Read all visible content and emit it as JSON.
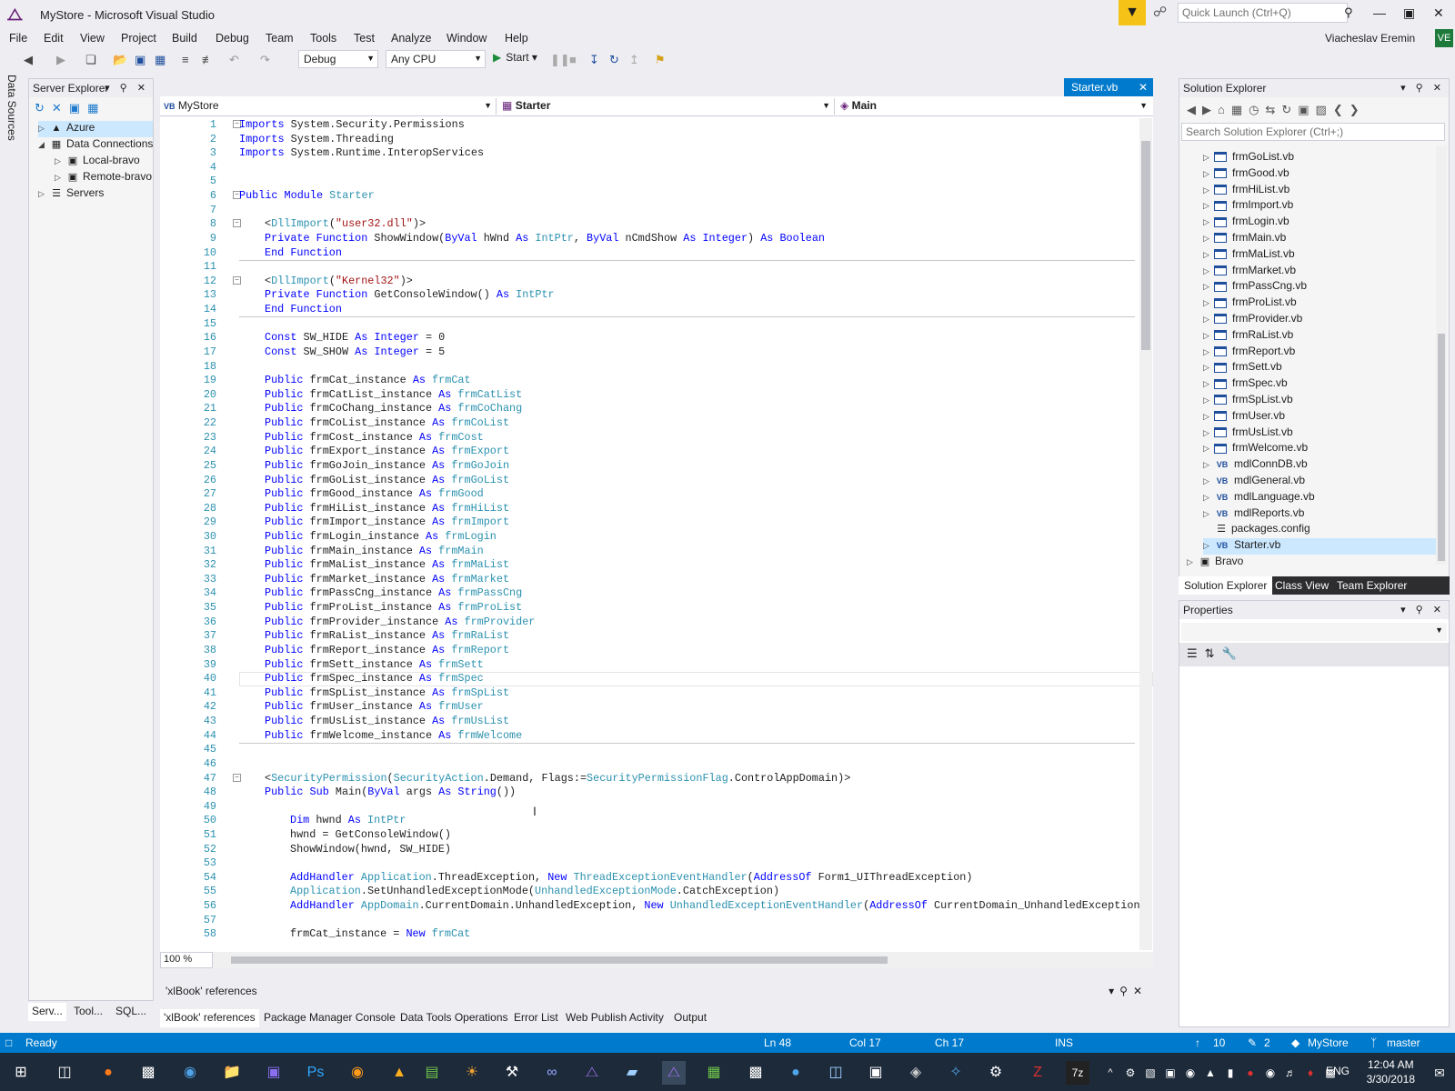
{
  "window": {
    "title": "MyStore - Microsoft Visual Studio",
    "quick_launch": "Quick Launch (Ctrl+Q)",
    "user": "Viacheslav Eremin",
    "avatar": "VE",
    "min": "—",
    "max": "▣",
    "close": "✕"
  },
  "menu": [
    "File",
    "Edit",
    "View",
    "Project",
    "Build",
    "Debug",
    "Team",
    "Tools",
    "Test",
    "Analyze",
    "Window",
    "Help"
  ],
  "toolbar": {
    "config": "Debug",
    "platform": "Any CPU",
    "start": "Start"
  },
  "left_strip": {
    "label": "Data Sources"
  },
  "server_explorer": {
    "title": "Server Explorer",
    "items": [
      {
        "label": "Azure",
        "arrow": "▷",
        "icon": "▲",
        "indent": 0,
        "selected": true
      },
      {
        "label": "Data Connections",
        "arrow": "◢",
        "icon": "▦",
        "indent": 0
      },
      {
        "label": "Local-bravo",
        "arrow": "▷",
        "icon": "▣",
        "indent": 1
      },
      {
        "label": "Remote-bravo",
        "arrow": "▷",
        "icon": "▣",
        "indent": 1
      },
      {
        "label": "Servers",
        "arrow": "▷",
        "icon": "☰",
        "indent": 0
      }
    ],
    "tabs": [
      "Serv...",
      "Tool...",
      "SQL..."
    ]
  },
  "editor": {
    "tab": "Starter.vb",
    "nav": {
      "project": "MyStore",
      "class": "Starter",
      "member": "Main"
    },
    "zoom": "100 %"
  },
  "code": [
    {
      "n": 1,
      "segs": [
        [
          "kw",
          "Imports"
        ],
        [
          "tx",
          " System.Security.Permissions"
        ]
      ],
      "ind": 0,
      "col": true
    },
    {
      "n": 2,
      "segs": [
        [
          "kw",
          "Imports"
        ],
        [
          "tx",
          " System.Threading"
        ]
      ],
      "ind": 0
    },
    {
      "n": 3,
      "segs": [
        [
          "kw",
          "Imports"
        ],
        [
          "tx",
          " System.Runtime.InteropServices"
        ]
      ],
      "ind": 0
    },
    {
      "n": 4,
      "segs": [],
      "ind": 0
    },
    {
      "n": 5,
      "segs": [],
      "ind": 0
    },
    {
      "n": 6,
      "segs": [
        [
          "kw",
          "Public Module"
        ],
        [
          "ty",
          " Starter"
        ]
      ],
      "ind": 0,
      "col": true
    },
    {
      "n": 7,
      "segs": [],
      "ind": 0
    },
    {
      "n": 8,
      "segs": [
        [
          "tx",
          "<"
        ],
        [
          "ty",
          "DllImport"
        ],
        [
          "tx",
          "("
        ],
        [
          "st",
          "\"user32.dll\""
        ],
        [
          "tx",
          ")>"
        ]
      ],
      "ind": 1,
      "col": true
    },
    {
      "n": 9,
      "segs": [
        [
          "kw",
          "Private Function"
        ],
        [
          "tx",
          " ShowWindow("
        ],
        [
          "kw",
          "ByVal"
        ],
        [
          "tx",
          " hWnd "
        ],
        [
          "kw",
          "As"
        ],
        [
          "ty",
          " IntPtr"
        ],
        [
          "tx",
          ", "
        ],
        [
          "kw",
          "ByVal"
        ],
        [
          "tx",
          " nCmdShow "
        ],
        [
          "kw",
          "As Integer"
        ],
        [
          "tx",
          ") "
        ],
        [
          "kw",
          "As Boolean"
        ]
      ],
      "ind": 1
    },
    {
      "n": 10,
      "segs": [
        [
          "kw",
          "End Function"
        ]
      ],
      "ind": 1,
      "sep": true
    },
    {
      "n": 11,
      "segs": [],
      "ind": 0
    },
    {
      "n": 12,
      "segs": [
        [
          "tx",
          "<"
        ],
        [
          "ty",
          "DllImport"
        ],
        [
          "tx",
          "("
        ],
        [
          "st",
          "\"Kernel32\""
        ],
        [
          "tx",
          ")>"
        ]
      ],
      "ind": 1,
      "col": true
    },
    {
      "n": 13,
      "segs": [
        [
          "kw",
          "Private Function"
        ],
        [
          "tx",
          " GetConsoleWindow() "
        ],
        [
          "kw",
          "As"
        ],
        [
          "ty",
          " IntPtr"
        ]
      ],
      "ind": 1
    },
    {
      "n": 14,
      "segs": [
        [
          "kw",
          "End Function"
        ]
      ],
      "ind": 1,
      "sep": true
    },
    {
      "n": 15,
      "segs": [],
      "ind": 0
    },
    {
      "n": 16,
      "segs": [
        [
          "kw",
          "Const"
        ],
        [
          "tx",
          " SW_HIDE "
        ],
        [
          "kw",
          "As Integer"
        ],
        [
          "tx",
          " = 0"
        ]
      ],
      "ind": 1
    },
    {
      "n": 17,
      "segs": [
        [
          "kw",
          "Const"
        ],
        [
          "tx",
          " SW_SHOW "
        ],
        [
          "kw",
          "As Integer"
        ],
        [
          "tx",
          " = 5"
        ]
      ],
      "ind": 1
    },
    {
      "n": 18,
      "segs": [],
      "ind": 0
    },
    {
      "n": 19,
      "segs": [
        [
          "kw",
          "Public"
        ],
        [
          "tx",
          " frmCat_instance "
        ],
        [
          "kw",
          "As"
        ],
        [
          "ty",
          " frmCat"
        ]
      ],
      "ind": 1
    },
    {
      "n": 20,
      "segs": [
        [
          "kw",
          "Public"
        ],
        [
          "tx",
          " frmCatList_instance "
        ],
        [
          "kw",
          "As"
        ],
        [
          "ty",
          " frmCatList"
        ]
      ],
      "ind": 1
    },
    {
      "n": 21,
      "segs": [
        [
          "kw",
          "Public"
        ],
        [
          "tx",
          " frmCoChang_instance "
        ],
        [
          "kw",
          "As"
        ],
        [
          "ty",
          " frmCoChang"
        ]
      ],
      "ind": 1
    },
    {
      "n": 22,
      "segs": [
        [
          "kw",
          "Public"
        ],
        [
          "tx",
          " frmCoList_instance "
        ],
        [
          "kw",
          "As"
        ],
        [
          "ty",
          " frmCoList"
        ]
      ],
      "ind": 1
    },
    {
      "n": 23,
      "segs": [
        [
          "kw",
          "Public"
        ],
        [
          "tx",
          " frmCost_instance "
        ],
        [
          "kw",
          "As"
        ],
        [
          "ty",
          " frmCost"
        ]
      ],
      "ind": 1
    },
    {
      "n": 24,
      "segs": [
        [
          "kw",
          "Public"
        ],
        [
          "tx",
          " frmExport_instance "
        ],
        [
          "kw",
          "As"
        ],
        [
          "ty",
          " frmExport"
        ]
      ],
      "ind": 1
    },
    {
      "n": 25,
      "segs": [
        [
          "kw",
          "Public"
        ],
        [
          "tx",
          " frmGoJoin_instance "
        ],
        [
          "kw",
          "As"
        ],
        [
          "ty",
          " frmGoJoin"
        ]
      ],
      "ind": 1
    },
    {
      "n": 26,
      "segs": [
        [
          "kw",
          "Public"
        ],
        [
          "tx",
          " frmGoList_instance "
        ],
        [
          "kw",
          "As"
        ],
        [
          "ty",
          " frmGoList"
        ]
      ],
      "ind": 1
    },
    {
      "n": 27,
      "segs": [
        [
          "kw",
          "Public"
        ],
        [
          "tx",
          " frmGood_instance "
        ],
        [
          "kw",
          "As"
        ],
        [
          "ty",
          " frmGood"
        ]
      ],
      "ind": 1
    },
    {
      "n": 28,
      "segs": [
        [
          "kw",
          "Public"
        ],
        [
          "tx",
          " frmHiList_instance "
        ],
        [
          "kw",
          "As"
        ],
        [
          "ty",
          " frmHiList"
        ]
      ],
      "ind": 1
    },
    {
      "n": 29,
      "segs": [
        [
          "kw",
          "Public"
        ],
        [
          "tx",
          " frmImport_instance "
        ],
        [
          "kw",
          "As"
        ],
        [
          "ty",
          " frmImport"
        ]
      ],
      "ind": 1
    },
    {
      "n": 30,
      "segs": [
        [
          "kw",
          "Public"
        ],
        [
          "tx",
          " frmLogin_instance "
        ],
        [
          "kw",
          "As"
        ],
        [
          "ty",
          " frmLogin"
        ]
      ],
      "ind": 1
    },
    {
      "n": 31,
      "segs": [
        [
          "kw",
          "Public"
        ],
        [
          "tx",
          " frmMain_instance "
        ],
        [
          "kw",
          "As"
        ],
        [
          "ty",
          " frmMain"
        ]
      ],
      "ind": 1
    },
    {
      "n": 32,
      "segs": [
        [
          "kw",
          "Public"
        ],
        [
          "tx",
          " frmMaList_instance "
        ],
        [
          "kw",
          "As"
        ],
        [
          "ty",
          " frmMaList"
        ]
      ],
      "ind": 1
    },
    {
      "n": 33,
      "segs": [
        [
          "kw",
          "Public"
        ],
        [
          "tx",
          " frmMarket_instance "
        ],
        [
          "kw",
          "As"
        ],
        [
          "ty",
          " frmMarket"
        ]
      ],
      "ind": 1
    },
    {
      "n": 34,
      "segs": [
        [
          "kw",
          "Public"
        ],
        [
          "tx",
          " frmPassCng_instance "
        ],
        [
          "kw",
          "As"
        ],
        [
          "ty",
          " frmPassCng"
        ]
      ],
      "ind": 1
    },
    {
      "n": 35,
      "segs": [
        [
          "kw",
          "Public"
        ],
        [
          "tx",
          " frmProList_instance "
        ],
        [
          "kw",
          "As"
        ],
        [
          "ty",
          " frmProList"
        ]
      ],
      "ind": 1
    },
    {
      "n": 36,
      "segs": [
        [
          "kw",
          "Public"
        ],
        [
          "tx",
          " frmProvider_instance "
        ],
        [
          "kw",
          "As"
        ],
        [
          "ty",
          " frmProvider"
        ]
      ],
      "ind": 1
    },
    {
      "n": 37,
      "segs": [
        [
          "kw",
          "Public"
        ],
        [
          "tx",
          " frmRaList_instance "
        ],
        [
          "kw",
          "As"
        ],
        [
          "ty",
          " frmRaList"
        ]
      ],
      "ind": 1
    },
    {
      "n": 38,
      "segs": [
        [
          "kw",
          "Public"
        ],
        [
          "tx",
          " frmReport_instance "
        ],
        [
          "kw",
          "As"
        ],
        [
          "ty",
          " frmReport"
        ]
      ],
      "ind": 1
    },
    {
      "n": 39,
      "segs": [
        [
          "kw",
          "Public"
        ],
        [
          "tx",
          " frmSett_instance "
        ],
        [
          "kw",
          "As"
        ],
        [
          "ty",
          " frmSett"
        ]
      ],
      "ind": 1
    },
    {
      "n": 40,
      "segs": [
        [
          "kw",
          "Public"
        ],
        [
          "tx",
          " frmSpec_instance "
        ],
        [
          "kw",
          "As"
        ],
        [
          "ty",
          " frmSpec"
        ]
      ],
      "ind": 1
    },
    {
      "n": 41,
      "segs": [
        [
          "kw",
          "Public"
        ],
        [
          "tx",
          " frmSpList_instance "
        ],
        [
          "kw",
          "As"
        ],
        [
          "ty",
          " frmSpList"
        ]
      ],
      "ind": 1
    },
    {
      "n": 42,
      "segs": [
        [
          "kw",
          "Public"
        ],
        [
          "tx",
          " frmUser_instance "
        ],
        [
          "kw",
          "As"
        ],
        [
          "ty",
          " frmUser"
        ]
      ],
      "ind": 1
    },
    {
      "n": 43,
      "segs": [
        [
          "kw",
          "Public"
        ],
        [
          "tx",
          " frmUsList_instance "
        ],
        [
          "kw",
          "As"
        ],
        [
          "ty",
          " frmUsList"
        ]
      ],
      "ind": 1
    },
    {
      "n": 44,
      "segs": [
        [
          "kw",
          "Public"
        ],
        [
          "tx",
          " frmWelcome_instance "
        ],
        [
          "kw",
          "As"
        ],
        [
          "ty",
          " frmWelcome"
        ]
      ],
      "ind": 1,
      "sep": true
    },
    {
      "n": 45,
      "segs": [],
      "ind": 0
    },
    {
      "n": 46,
      "segs": [],
      "ind": 0
    },
    {
      "n": 47,
      "segs": [
        [
          "tx",
          "<"
        ],
        [
          "ty",
          "SecurityPermission"
        ],
        [
          "tx",
          "("
        ],
        [
          "ty",
          "SecurityAction"
        ],
        [
          "tx",
          ".Demand, Flags:="
        ],
        [
          "ty",
          "SecurityPermissionFlag"
        ],
        [
          "tx",
          ".ControlAppDomain)>"
        ]
      ],
      "ind": 1,
      "col": true
    },
    {
      "n": 48,
      "segs": [
        [
          "kw",
          "Public Sub"
        ],
        [
          "tx",
          " Main("
        ],
        [
          "kw",
          "ByVal"
        ],
        [
          "tx",
          " args "
        ],
        [
          "kw",
          "As String"
        ],
        [
          "tx",
          "())"
        ]
      ],
      "ind": 1
    },
    {
      "n": 49,
      "segs": [],
      "ind": 0
    },
    {
      "n": 50,
      "segs": [
        [
          "kw",
          "Dim"
        ],
        [
          "tx",
          " hwnd "
        ],
        [
          "kw",
          "As"
        ],
        [
          "ty",
          " IntPtr"
        ]
      ],
      "ind": 2
    },
    {
      "n": 51,
      "segs": [
        [
          "tx",
          "hwnd = GetConsoleWindow()"
        ]
      ],
      "ind": 2
    },
    {
      "n": 52,
      "segs": [
        [
          "tx",
          "ShowWindow(hwnd, SW_HIDE)"
        ]
      ],
      "ind": 2
    },
    {
      "n": 53,
      "segs": [],
      "ind": 0
    },
    {
      "n": 54,
      "segs": [
        [
          "kw",
          "AddHandler"
        ],
        [
          "ty",
          " Application"
        ],
        [
          "tx",
          ".ThreadException, "
        ],
        [
          "kw",
          "New"
        ],
        [
          "ty",
          " ThreadExceptionEventHandler"
        ],
        [
          "tx",
          "("
        ],
        [
          "kw",
          "AddressOf"
        ],
        [
          "tx",
          " Form1_UIThreadException)"
        ]
      ],
      "ind": 2
    },
    {
      "n": 55,
      "segs": [
        [
          "ty",
          "Application"
        ],
        [
          "tx",
          ".SetUnhandledExceptionMode("
        ],
        [
          "ty",
          "UnhandledExceptionMode"
        ],
        [
          "tx",
          ".CatchException)"
        ]
      ],
      "ind": 2
    },
    {
      "n": 56,
      "segs": [
        [
          "kw",
          "AddHandler"
        ],
        [
          "ty",
          " AppDomain"
        ],
        [
          "tx",
          ".CurrentDomain.UnhandledException, "
        ],
        [
          "kw",
          "New"
        ],
        [
          "ty",
          " UnhandledExceptionEventHandler"
        ],
        [
          "tx",
          "("
        ],
        [
          "kw",
          "AddressOf"
        ],
        [
          "tx",
          " CurrentDomain_UnhandledException)"
        ]
      ],
      "ind": 2
    },
    {
      "n": 57,
      "segs": [],
      "ind": 0
    },
    {
      "n": 58,
      "segs": [
        [
          "tx",
          "frmCat_instance = "
        ],
        [
          "kw",
          "New"
        ],
        [
          "ty",
          " frmCat"
        ]
      ],
      "ind": 2
    }
  ],
  "solution_explorer": {
    "title": "Solution Explorer",
    "search": "Search Solution Explorer (Ctrl+;)",
    "items": [
      {
        "label": "frmGoList.vb",
        "t": "form"
      },
      {
        "label": "frmGood.vb",
        "t": "form"
      },
      {
        "label": "frmHiList.vb",
        "t": "form"
      },
      {
        "label": "frmImport.vb",
        "t": "form"
      },
      {
        "label": "frmLogin.vb",
        "t": "form"
      },
      {
        "label": "frmMain.vb",
        "t": "form"
      },
      {
        "label": "frmMaList.vb",
        "t": "form"
      },
      {
        "label": "frmMarket.vb",
        "t": "form"
      },
      {
        "label": "frmPassCng.vb",
        "t": "form"
      },
      {
        "label": "frmProList.vb",
        "t": "form"
      },
      {
        "label": "frmProvider.vb",
        "t": "form"
      },
      {
        "label": "frmRaList.vb",
        "t": "form"
      },
      {
        "label": "frmReport.vb",
        "t": "form"
      },
      {
        "label": "frmSett.vb",
        "t": "form"
      },
      {
        "label": "frmSpec.vb",
        "t": "form"
      },
      {
        "label": "frmSpList.vb",
        "t": "form"
      },
      {
        "label": "frmUser.vb",
        "t": "form"
      },
      {
        "label": "frmUsList.vb",
        "t": "form"
      },
      {
        "label": "frmWelcome.vb",
        "t": "form"
      },
      {
        "label": "mdlConnDB.vb",
        "t": "vb"
      },
      {
        "label": "mdlGeneral.vb",
        "t": "vb"
      },
      {
        "label": "mdlLanguage.vb",
        "t": "vb"
      },
      {
        "label": "mdlReports.vb",
        "t": "vb"
      },
      {
        "label": "packages.config",
        "t": "cfg"
      },
      {
        "label": "Starter.vb",
        "t": "vb",
        "sel": true
      },
      {
        "label": "Bravo",
        "t": "proj"
      }
    ],
    "tabs": [
      "Solution Explorer",
      "Class View",
      "Team Explorer"
    ]
  },
  "properties": {
    "title": "Properties"
  },
  "refs": {
    "title": "'xlBook' references"
  },
  "bottom_tabs": [
    "'xlBook' references",
    "Package Manager Console",
    "Data Tools Operations",
    "Error List",
    "Web Publish Activity",
    "Output"
  ],
  "status": {
    "ready": "Ready",
    "ln": "Ln 48",
    "col": "Col 17",
    "ch": "Ch 17",
    "ins": "INS",
    "up": "10",
    "pen": "2",
    "project": "MyStore",
    "branch": "master"
  },
  "taskbar": {
    "lang": "ENG",
    "time": "12:04 AM",
    "date": "3/30/2018"
  }
}
